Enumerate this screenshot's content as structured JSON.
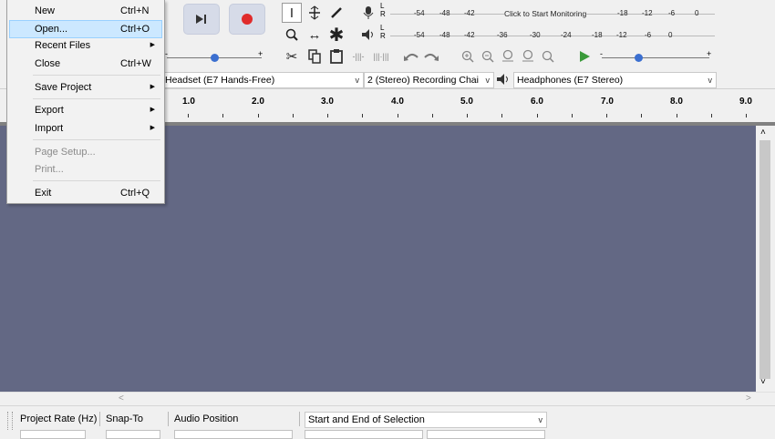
{
  "colors": {
    "track_bg": "#636884",
    "accent": "#cce8ff",
    "record": "#e02b2b",
    "play_green": "#3a9a3a"
  },
  "menu": {
    "items": [
      {
        "label": "New",
        "shortcut": "Ctrl+N",
        "enabled": true,
        "highlight": false
      },
      {
        "label": "Open...",
        "shortcut": "Ctrl+O",
        "enabled": true,
        "highlight": true
      },
      {
        "label": "Recent Files",
        "submenu": true,
        "enabled": true
      },
      {
        "label": "Close",
        "shortcut": "Ctrl+W",
        "enabled": true
      },
      {
        "label": "Save Project",
        "submenu": true,
        "enabled": true
      },
      {
        "label": "Export",
        "submenu": true,
        "enabled": true
      },
      {
        "label": "Import",
        "submenu": true,
        "enabled": true
      },
      {
        "label": "Page Setup...",
        "enabled": false
      },
      {
        "label": "Print...",
        "enabled": false
      },
      {
        "label": "Exit",
        "shortcut": "Ctrl+Q",
        "enabled": true
      }
    ]
  },
  "meters": {
    "record_ticks": [
      "-54",
      "-48",
      "-42",
      "-18",
      "-12",
      "-6",
      "0"
    ],
    "record_hint": "Click to Start Monitoring",
    "play_ticks": [
      "-54",
      "-48",
      "-42",
      "-36",
      "-30",
      "-24",
      "-18",
      "-12",
      "-6",
      "0"
    ],
    "L": "L",
    "R": "R"
  },
  "devices": {
    "recording_device": "Headset (E7 Hands-Free)",
    "channels": "2 (Stereo) Recording Chai",
    "playback_device": "Headphones (E7 Stereo)"
  },
  "ruler": {
    "labels": [
      "1.0",
      "2.0",
      "3.0",
      "4.0",
      "5.0",
      "6.0",
      "7.0",
      "8.0",
      "9.0"
    ]
  },
  "selection_bar": {
    "project_rate_label": "Project Rate (Hz)",
    "snap_to_label": "Snap-To",
    "audio_position_label": "Audio Position",
    "selection_mode": "Start and End of Selection"
  }
}
